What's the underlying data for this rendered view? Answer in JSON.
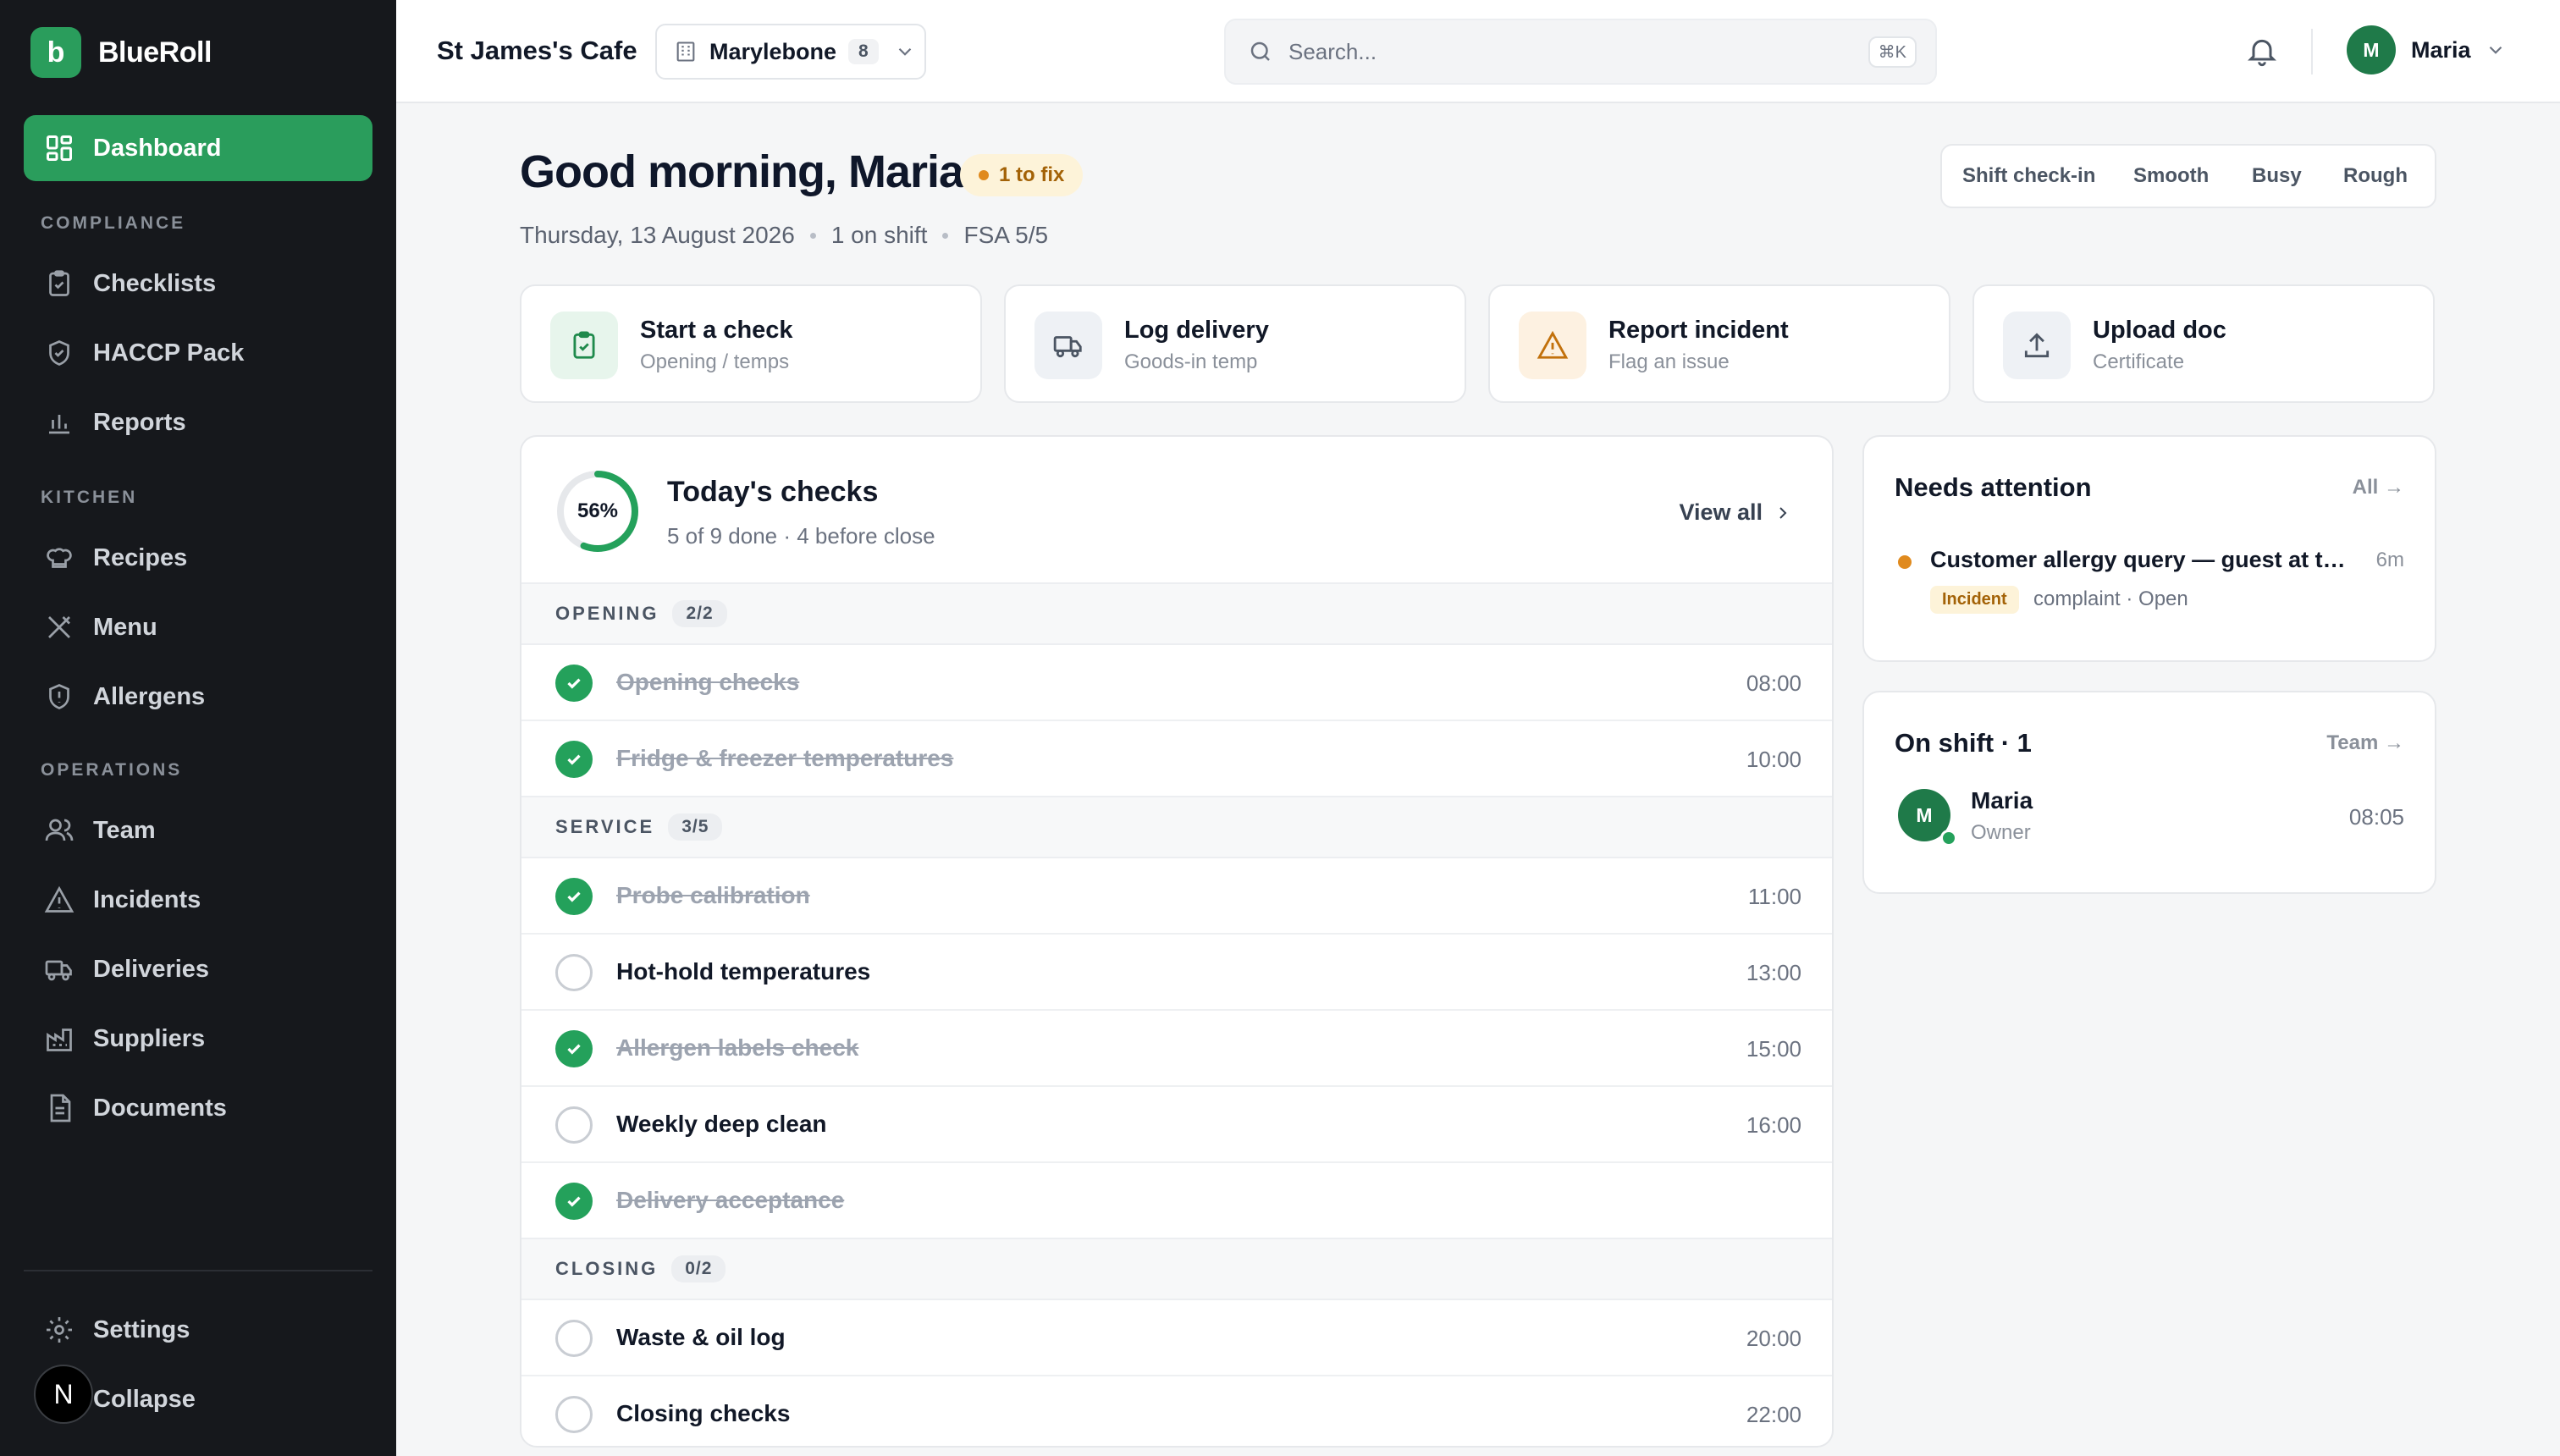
{
  "brand": {
    "logo_letter": "b",
    "name": "BlueRoll"
  },
  "sidebar": {
    "dashboard": "Dashboard",
    "sections": {
      "compliance": "COMPLIANCE",
      "kitchen": "KITCHEN",
      "operations": "OPERATIONS"
    },
    "items": {
      "checklists": "Checklists",
      "haccp": "HACCP Pack",
      "reports": "Reports",
      "recipes": "Recipes",
      "menu": "Menu",
      "allergens": "Allergens",
      "team": "Team",
      "incidents": "Incidents",
      "deliveries": "Deliveries",
      "suppliers": "Suppliers",
      "documents": "Documents",
      "settings": "Settings",
      "collapse": "Collapse"
    },
    "dev_badge": "N"
  },
  "topbar": {
    "cafe_name": "St James's Cafe",
    "location": "Marylebone",
    "location_count": "8",
    "search_placeholder": "Search...",
    "search_shortcut": "⌘K",
    "user_initial": "M",
    "user_name": "Maria"
  },
  "header": {
    "greeting": "Good morning, Maria",
    "fix_badge": "1 to fix",
    "date": "Thursday, 13 August 2026",
    "on_shift": "1 on shift",
    "fsa": "FSA 5/5",
    "checkin": {
      "label": "Shift check-in",
      "options": [
        "Smooth",
        "Busy",
        "Rough"
      ]
    }
  },
  "quick_actions": [
    {
      "title": "Start a check",
      "subtitle": "Opening / temps"
    },
    {
      "title": "Log delivery",
      "subtitle": "Goods-in temp"
    },
    {
      "title": "Report incident",
      "subtitle": "Flag an issue"
    },
    {
      "title": "Upload doc",
      "subtitle": "Certificate"
    }
  ],
  "checks": {
    "percent_label": "56%",
    "progress": 0.56,
    "title": "Today's checks",
    "subtitle": "5 of 9 done · 4 before close",
    "view_all": "View all",
    "sections": [
      {
        "name": "OPENING",
        "count": "2/2",
        "items": [
          {
            "label": "Opening checks",
            "time": "08:00",
            "done": true
          },
          {
            "label": "Fridge & freezer temperatures",
            "time": "10:00",
            "done": true
          }
        ]
      },
      {
        "name": "SERVICE",
        "count": "3/5",
        "items": [
          {
            "label": "Probe calibration",
            "time": "11:00",
            "done": true
          },
          {
            "label": "Hot-hold temperatures",
            "time": "13:00",
            "done": false
          },
          {
            "label": "Allergen labels check",
            "time": "15:00",
            "done": true
          },
          {
            "label": "Weekly deep clean",
            "time": "16:00",
            "done": false
          },
          {
            "label": "Delivery acceptance",
            "time": "",
            "done": true
          }
        ]
      },
      {
        "name": "CLOSING",
        "count": "0/2",
        "items": [
          {
            "label": "Waste & oil log",
            "time": "20:00",
            "done": false
          },
          {
            "label": "Closing checks",
            "time": "22:00",
            "done": false
          }
        ]
      }
    ]
  },
  "attention": {
    "title": "Needs attention",
    "link": "All →",
    "item": {
      "title": "Customer allergy query — guest at table",
      "time": "6m",
      "badge": "Incident",
      "meta": "complaint · Open"
    }
  },
  "shift": {
    "title": "On shift · 1",
    "link": "Team →",
    "person": {
      "initial": "M",
      "name": "Maria",
      "role": "Owner",
      "time": "08:05"
    }
  },
  "colors": {
    "accent": "#2a9d5c",
    "sidebar_bg": "#16181c",
    "warning": "#e08a1e"
  }
}
